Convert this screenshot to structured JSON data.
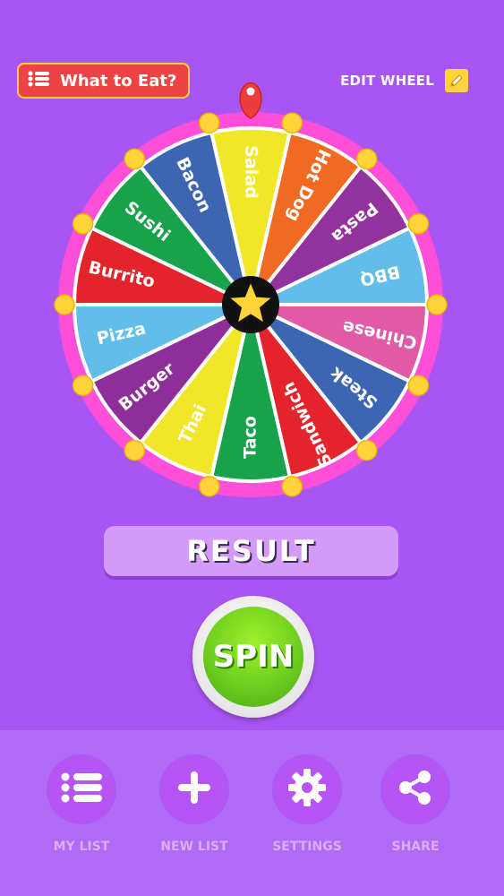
{
  "header": {
    "wheel_title": "What to Eat?",
    "edit_wheel_label": "EDIT WHEEL"
  },
  "wheel": {
    "segments": [
      {
        "label": "Salad",
        "color": "#f2e629"
      },
      {
        "label": "Hot Dog",
        "color": "#f16a22"
      },
      {
        "label": "Pasta",
        "color": "#92329c"
      },
      {
        "label": "BBQ",
        "color": "#63bde9"
      },
      {
        "label": "Chinese",
        "color": "#e05aa6"
      },
      {
        "label": "Steak",
        "color": "#3c66b2"
      },
      {
        "label": "Sandwich",
        "color": "#e3242b"
      },
      {
        "label": "Taco",
        "color": "#18a24b"
      },
      {
        "label": "Thai",
        "color": "#f2e629"
      },
      {
        "label": "Burger",
        "color": "#8e2f99"
      },
      {
        "label": "Pizza",
        "color": "#63bde9"
      },
      {
        "label": "Burrito",
        "color": "#e3242b"
      },
      {
        "label": "Sushi",
        "color": "#18a24b"
      },
      {
        "label": "Bacon",
        "color": "#3c66b2"
      }
    ],
    "rim_color": "#ff4fd8",
    "peg_color": "#ffd43b",
    "pointer_color": "#ee3b3b",
    "center_icon": "star-icon"
  },
  "result": {
    "label": "RESULT"
  },
  "spin": {
    "label": "SPIN"
  },
  "nav": {
    "items": [
      {
        "label": "MY LIST",
        "icon": "list-icon"
      },
      {
        "label": "NEW LIST",
        "icon": "plus-icon"
      },
      {
        "label": "SETTINGS",
        "icon": "gear-icon"
      },
      {
        "label": "SHARE",
        "icon": "share-icon"
      }
    ]
  }
}
